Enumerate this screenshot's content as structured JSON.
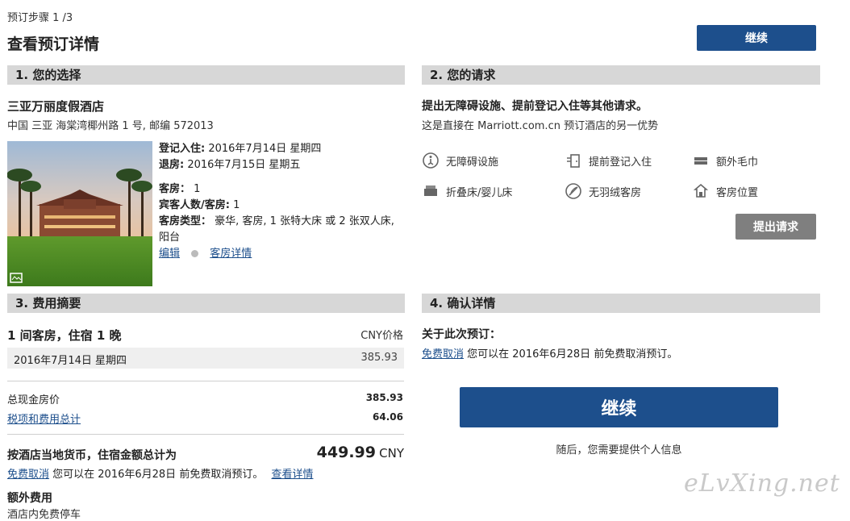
{
  "header": {
    "step": "预订步骤 1 /3",
    "title": "查看预订详情",
    "continue_label": "继续"
  },
  "section1": {
    "heading": "1. 您的选择",
    "hotel_name": "三亚万丽度假酒店",
    "address": "中国 三亚 海棠湾椰州路 1 号, 邮编 572013",
    "checkin_label": "登记入住:",
    "checkin_value": "2016年7月14日 星期四",
    "checkout_label": "退房:",
    "checkout_value": "2016年7月15日 星期五",
    "rooms_label": "客房：",
    "rooms_value": "1",
    "guests_label": "宾客人数/客房:",
    "guests_value": "1",
    "roomtype_label": "客房类型：",
    "roomtype_value": "豪华, 客房, 1 张特大床 或 2 张双人床, 阳台",
    "edit_link": "编辑",
    "room_details_link": "客房详情"
  },
  "section2": {
    "heading": "2. 您的请求",
    "intro_bold": "提出无障碍设施、提前登记入住等其他请求。",
    "intro_sub": "这是直接在 Marriott.com.cn 预订酒店的另一优势",
    "requests": [
      {
        "label": "无障碍设施",
        "icon": "accessibility-icon"
      },
      {
        "label": "提前登记入住",
        "icon": "early-checkin-icon"
      },
      {
        "label": "额外毛巾",
        "icon": "towel-icon"
      },
      {
        "label": "折叠床/婴儿床",
        "icon": "rollaway-bed-icon"
      },
      {
        "label": "无羽绒客房",
        "icon": "no-feather-icon"
      },
      {
        "label": "客房位置",
        "icon": "room-location-icon"
      }
    ],
    "submit_label": "提出请求"
  },
  "section3": {
    "heading": "3. 费用摘要",
    "stay_label": "1 间客房，住宿 1 晚",
    "currency_label": "CNY价格",
    "date_label": "2016年7月14日 星期四",
    "date_price": "385.93",
    "total_room_label": "总现金房价",
    "total_room_value": "385.93",
    "tax_label": "税项和费用总计",
    "tax_value": "64.06",
    "grand_label": "按酒店当地货币，住宿金额总计为",
    "grand_value": "449.99",
    "grand_currency": "CNY",
    "free_cancel_link": "免费取消",
    "cancel_text": "您可以在 2016年6月28日 前免费取消预订。",
    "view_details_link": "查看详情",
    "extra_fees": "额外费用",
    "extra_fees_sub": "酒店内免费停车"
  },
  "section4": {
    "heading": "4. 确认详情",
    "about_label": "关于此次预订：",
    "free_cancel_link": "免费取消",
    "cancel_text": "您可以在 2016年6月28日 前免费取消预订。",
    "continue_label": "继续",
    "next_note": "随后，您需要提供个人信息"
  },
  "watermark": "eLvXing.net"
}
